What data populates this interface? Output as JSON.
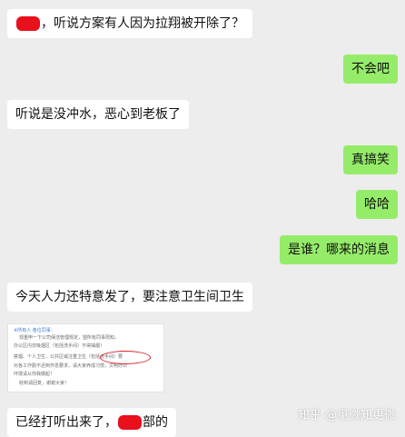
{
  "messages": [
    {
      "side": "left",
      "before": "",
      "after": "，听说方案有人因为拉翔被开除了？"
    },
    {
      "side": "right",
      "text": "不会吧"
    },
    {
      "side": "left",
      "text": "听说是没冲水，恶心到老板了"
    },
    {
      "side": "right",
      "text": "真搞笑"
    },
    {
      "side": "right",
      "text": "哈哈"
    },
    {
      "side": "right",
      "text": "是谁？哪来的消息"
    },
    {
      "side": "left",
      "text": "今天人力还特意发了，要注意卫生间卫生"
    },
    {
      "side": "left",
      "text": "已经打听出来了，",
      "after": "部的"
    }
  ],
  "image_message": {
    "lines": [
      "※所有人 各位同事：",
      "现重申一下公司保洁管理规定，望所有同事周知。",
      "办公区内非吸烟区（包括洗手间）不得抽烟！",
      "禁烟、个人卫生、公共区域注重卫生（包括洗手间）要",
      "对各工作勤不迟到作息要求，请大家养成习惯，文明办公",
      "环境请从你我做起！",
      "收到请回复，谢谢大家！"
    ]
  },
  "watermark": "知乎 @见微知更微",
  "colors": {
    "background": "#ededed",
    "incoming_bubble": "#ffffff",
    "outgoing_bubble": "#95ec69",
    "redaction": "#e8101c"
  }
}
